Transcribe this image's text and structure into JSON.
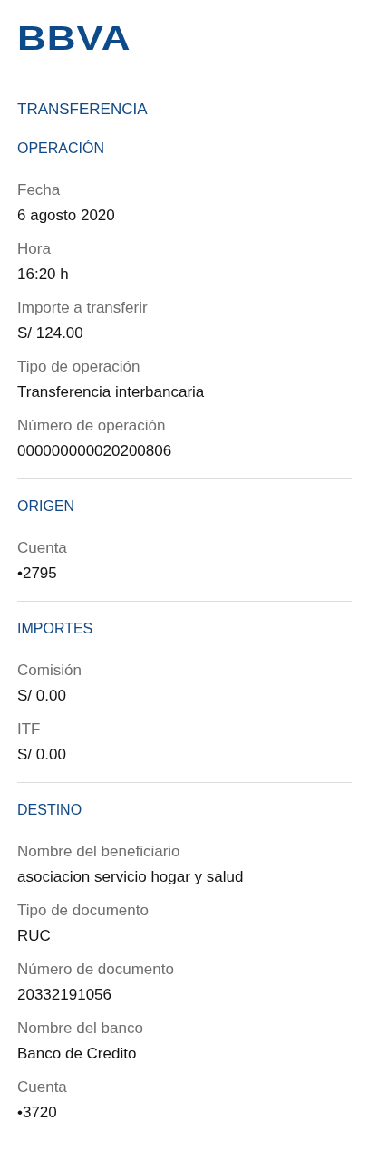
{
  "logo": "BBVA",
  "title": "TRANSFERENCIA",
  "sections": [
    {
      "title": "OPERACIÓN",
      "fields": [
        {
          "label": "Fecha",
          "value": "6 agosto 2020"
        },
        {
          "label": "Hora",
          "value": "16:20 h"
        },
        {
          "label": "Importe a transferir",
          "value": "S/ 124.00"
        },
        {
          "label": "Tipo de operación",
          "value": "Transferencia interbancaria"
        },
        {
          "label": "Número de operación",
          "value": "000000000020200806"
        }
      ]
    },
    {
      "title": "ORIGEN",
      "fields": [
        {
          "label": "Cuenta",
          "value": "•2795"
        }
      ]
    },
    {
      "title": "IMPORTES",
      "fields": [
        {
          "label": "Comisión",
          "value": "S/ 0.00"
        },
        {
          "label": "ITF",
          "value": "S/ 0.00"
        }
      ]
    },
    {
      "title": "DESTINO",
      "fields": [
        {
          "label": "Nombre del beneficiario",
          "value": "asociacion servicio hogar y salud"
        },
        {
          "label": "Tipo de documento",
          "value": "RUC"
        },
        {
          "label": "Número de documento",
          "value": "20332191056"
        },
        {
          "label": "Nombre del banco",
          "value": "Banco de Credito"
        },
        {
          "label": "Cuenta",
          "value": "•3720"
        }
      ]
    }
  ]
}
